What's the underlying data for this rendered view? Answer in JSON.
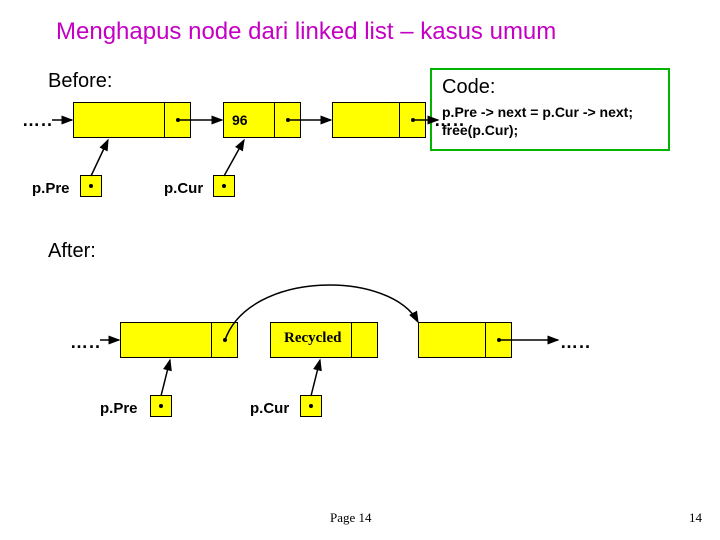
{
  "title": "Menghapus node dari linked list – kasus umum",
  "labels": {
    "before": "Before:",
    "code": "Code:",
    "after": "After:"
  },
  "code": {
    "line1": "p.Pre -> next = p.Cur -> next;",
    "line2": "free(p.Cur);"
  },
  "before": {
    "node2_value": "96",
    "ppre": "p.Pre",
    "pcur": "p.Cur"
  },
  "after": {
    "recycled": "Recycled",
    "ppre": "p.Pre",
    "pcur": "p.Cur"
  },
  "dots": "…..",
  "footer": {
    "page": "Page 14",
    "pagenum": "14"
  }
}
